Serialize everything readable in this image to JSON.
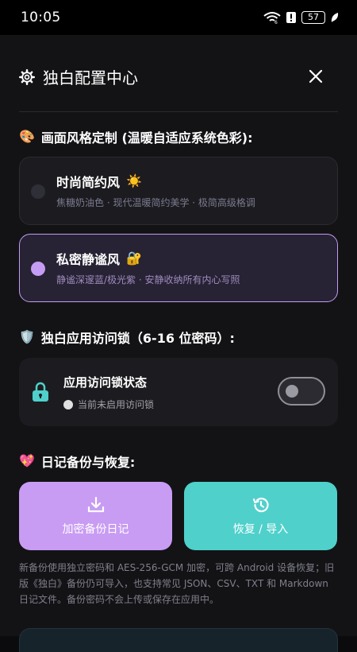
{
  "status_bar": {
    "time": "10:05",
    "battery": "57"
  },
  "header": {
    "title": "独白配置中心"
  },
  "theme_section": {
    "title": "画面风格定制 (温暖自适应系统色彩):",
    "options": [
      {
        "name": "时尚简约风",
        "description": "焦糖奶油色 · 现代温暖简约美学 · 极简高级格调",
        "selected": false
      },
      {
        "name": "私密静谧风",
        "description": "静谧深邃蓝/极光紫 · 安静收纳所有内心写照",
        "selected": true
      }
    ]
  },
  "lock_section": {
    "title": "独白应用访问锁（6-16 位密码）:",
    "card_title": "应用访问锁状态",
    "status_text": "当前未启用访问锁",
    "enabled": false
  },
  "backup_section": {
    "title": "日记备份与恢复:",
    "backup_label": "加密备份日记",
    "restore_label": "恢复 / 导入",
    "footnote": "新备份使用独立密码和 AES-256-GCM 加密，可跨 Android 设备恢复；旧版《独白》备份仍可导入，也支持常见 JSON、CSV、TXT 和 Markdown 日记文件。备份密码不会上传或保存在应用中。"
  },
  "colors": {
    "accent_purple": "#c89cf3",
    "accent_teal": "#4fd0cb",
    "background": "#131316"
  }
}
